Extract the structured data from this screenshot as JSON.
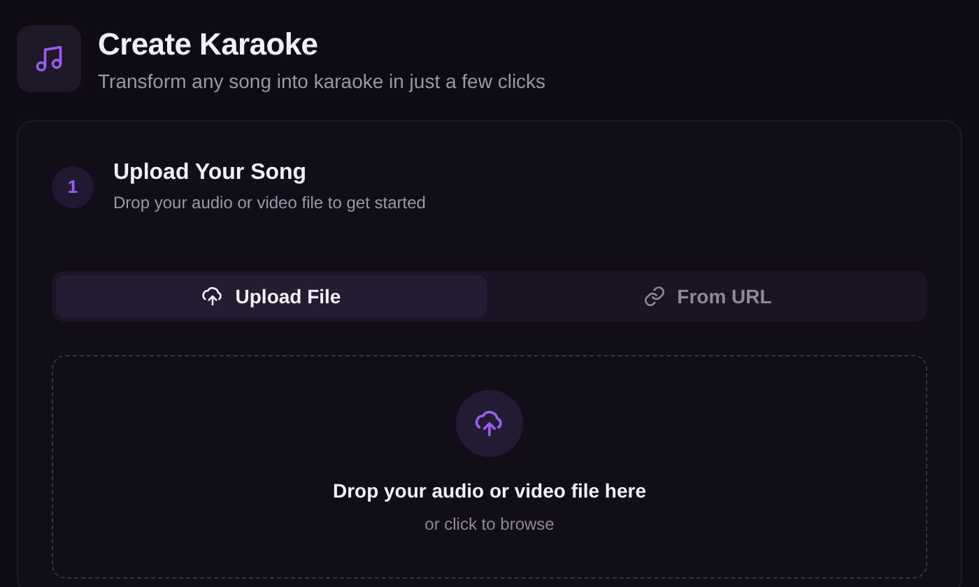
{
  "header": {
    "title": "Create Karaoke",
    "subtitle": "Transform any song into karaoke in just a few clicks"
  },
  "step": {
    "number": "1",
    "title": "Upload Your Song",
    "subtitle": "Drop your audio or video file to get started"
  },
  "tabs": [
    {
      "label": "Upload File",
      "kind": "upload",
      "selected": true
    },
    {
      "label": "From URL",
      "kind": "link",
      "selected": false
    }
  ],
  "dropzone": {
    "title": "Drop your audio or video file here",
    "hint": "or click to browse"
  }
}
